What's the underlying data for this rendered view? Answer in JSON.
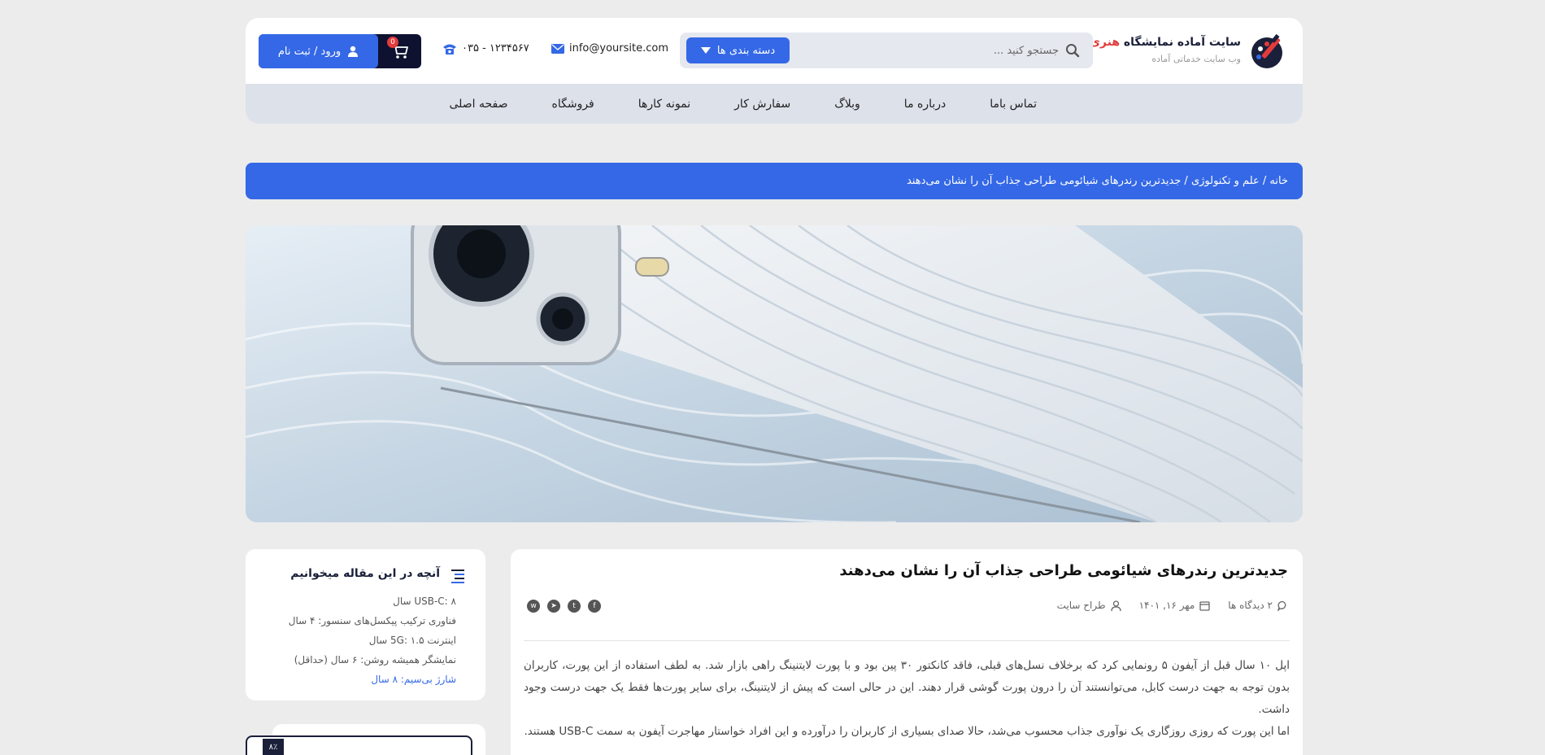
{
  "site": {
    "title_main": "سایت آماده نمایشگاه ",
    "title_accent": "هنری",
    "subtitle": "وب سایت خدماتی آماده"
  },
  "search": {
    "placeholder": "جستجو کنید ..."
  },
  "category_button": "دسته بندی ها",
  "contact": {
    "email": "info@yoursite.com",
    "phone": "۰۳۵ - ۱۲۳۴۵۶۷"
  },
  "auth": {
    "login_label": "ورود / ثبت نام",
    "cart_count": "0"
  },
  "nav": [
    {
      "label": "صفحه اصلی"
    },
    {
      "label": "فروشگاه"
    },
    {
      "label": "نمونه کارها"
    },
    {
      "label": "سفارش کار"
    },
    {
      "label": "وبلاگ"
    },
    {
      "label": "درباره ما"
    },
    {
      "label": "تماس باما"
    }
  ],
  "breadcrumb": "خانه / علم و تکنولوژی / جدیدترین رندرهای شیائومی طراحی جذاب آن را نشان می‌دهند",
  "article": {
    "title": "جدیدترین رندرهای شیائومی طراحی جذاب آن را نشان می‌دهند",
    "author": "طراح سایت",
    "date": "مهر ۱۶, ۱۴۰۱",
    "comments": "۲ دیدگاه ها",
    "paragraph1": "اپل ۱۰ سال قبل از آیفون ۵ رونمایی کرد که برخلاف نسل‌های قبلی، فاقد کانکتور ۳۰ پین بود و با پورت لایتنینگ راهی بازار شد. به لطف استفاده از این پورت، کاربران بدون توجه به جهت درست کابل، می‌توانستند آن را درون پورت گوشی قرار دهند. این در حالی است که پیش از لایتنینگ، برای سایر پورت‌ها فقط یک جهت درست وجود داشت.",
    "paragraph2": "اما این پورت که روزی روزگاری یک نوآوری جذاب محسوب می‌شد، حالا صدای بسیاری از کاربران را درآورده و این افراد خواستار مهاجرت آیفون به سمت USB-C هستند."
  },
  "toc": {
    "title": "آنچه در این مقاله میخوانیم",
    "items": [
      {
        "label": "USB-C: ۸ سال"
      },
      {
        "label": "فناوری ترکیب پیکسل‌های سنسور: ۴ سال"
      },
      {
        "label": "اینترنت 5G: ۱.۵ سال"
      },
      {
        "label": "نمایشگر همیشه روشن: ۶ سال (حداقل)"
      },
      {
        "label": "شارژ بی‌سیم: ۸ سال"
      }
    ]
  },
  "reading_progress": "۸٪",
  "colors": {
    "primary": "#3468e6",
    "dark": "#0e1230",
    "accent": "#e23b3b"
  }
}
